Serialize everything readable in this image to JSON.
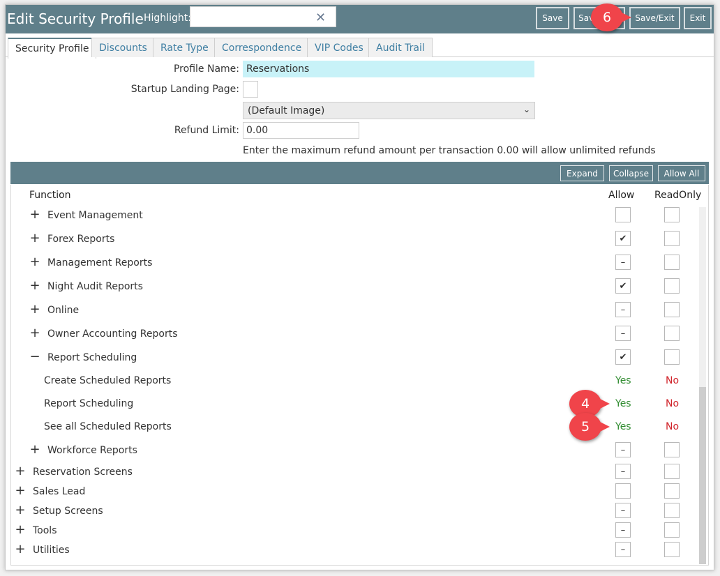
{
  "header": {
    "title": "Edit Security Profile",
    "highlight_label": "Highlight:",
    "highlight_value": "",
    "clear_symbol": "✕",
    "buttons": {
      "save": "Save",
      "save_new": "Save/New",
      "save_exit": "Save/Exit",
      "exit": "Exit"
    }
  },
  "tabs": [
    "Security Profile",
    "Discounts",
    "Rate Type",
    "Correspondence",
    "VIP Codes",
    "Audit Trail"
  ],
  "form": {
    "profile_name_label": "Profile Name:",
    "profile_name_value": "Reservations",
    "startup_label": "Startup Landing Page:",
    "default_image_option": "(Default Image)",
    "refund_label": "Refund Limit:",
    "refund_value": "0.00",
    "refund_help": "Enter the maximum refund amount per transaction 0.00 will allow unlimited refunds"
  },
  "section_buttons": {
    "expand": "Expand",
    "collapse": "Collapse",
    "allow_all": "Allow All"
  },
  "columns": {
    "function": "Function",
    "allow": "Allow",
    "readonly": "ReadOnly"
  },
  "rows": [
    {
      "label": "Event Management",
      "toggle": "+",
      "allow": "",
      "readonly": ""
    },
    {
      "label": "Forex Reports",
      "toggle": "+",
      "allow": "✔",
      "readonly": ""
    },
    {
      "label": "Management Reports",
      "toggle": "+",
      "allow": "–",
      "readonly": ""
    },
    {
      "label": "Night Audit Reports",
      "toggle": "+",
      "allow": "✔",
      "readonly": ""
    },
    {
      "label": "Online",
      "toggle": "+",
      "allow": "–",
      "readonly": ""
    },
    {
      "label": "Owner Accounting Reports",
      "toggle": "+",
      "allow": "–",
      "readonly": ""
    },
    {
      "label": "Report Scheduling",
      "toggle": "−",
      "allow": "✔",
      "readonly": ""
    },
    {
      "label": "Create Scheduled Reports",
      "yes": "Yes",
      "no": "No"
    },
    {
      "label": "Report Scheduling",
      "yes": "Yes",
      "no": "No"
    },
    {
      "label": "See all Scheduled Reports",
      "yes": "Yes",
      "no": "No"
    },
    {
      "label": "Workforce Reports",
      "toggle": "+",
      "allow": "–",
      "readonly": ""
    },
    {
      "label": "Reservation Screens",
      "toggle": "+",
      "allow": "–",
      "readonly": ""
    },
    {
      "label": "Sales Lead",
      "toggle": "+",
      "allow": "",
      "readonly": ""
    },
    {
      "label": "Setup Screens",
      "toggle": "+",
      "allow": "–",
      "readonly": ""
    },
    {
      "label": "Tools",
      "toggle": "+",
      "allow": "–",
      "readonly": ""
    },
    {
      "label": "Utilities",
      "toggle": "+",
      "allow": "–",
      "readonly": ""
    }
  ],
  "callouts": {
    "b4": "4",
    "b5": "5",
    "b6": "6"
  },
  "colors": {
    "header_bg": "#5f7f8a",
    "callout": "#f0444a",
    "yes": "#2e8b2e",
    "no": "#d0232a",
    "name_field_bg": "#c8f2f8"
  }
}
